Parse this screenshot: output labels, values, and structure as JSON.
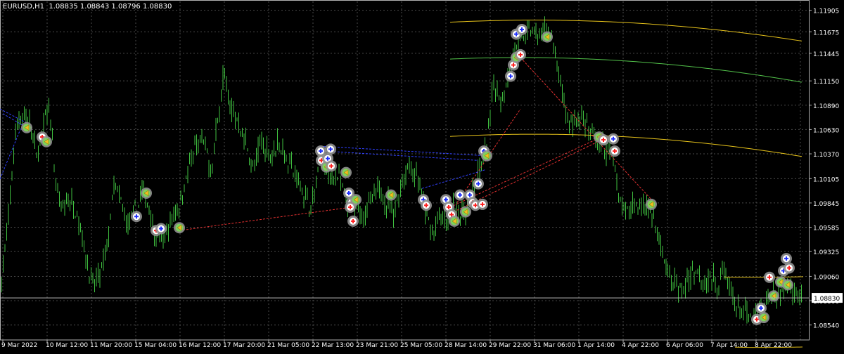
{
  "window": {
    "symbol_caption": "EURUSD,H1  1.08835 1.08843 1.08796 1.08830"
  },
  "colors": {
    "background": "#000000",
    "grid": "#4a4a4a",
    "frame": "#b0b0b0",
    "candle": "#3fbf3f",
    "channel": "#e6c21a",
    "regression_mid": "#52c24a",
    "red_link": "#e03030",
    "blue_link": "#3040ff",
    "marker_ring": "#909090",
    "price_tag_bg": "#ffffff",
    "price_tag_text": "#000000",
    "axis_text": "#ffffff"
  },
  "chart_data": {
    "type": "candlestick",
    "symbol": "EURUSD",
    "timeframe": "H1",
    "last_price": "1.08830",
    "ylim": [
      1.0838,
      1.12
    ],
    "y_ticks": [
      "1.11905",
      "1.11675",
      "1.11445",
      "1.11150",
      "1.10890",
      "1.10630",
      "1.10370",
      "1.10105",
      "1.09845",
      "1.09585",
      "1.09325",
      "1.09060",
      "1.08800",
      "1.08540"
    ],
    "x_ticks": [
      "9 Mar 2022",
      "10 Mar 12:00",
      "11 Mar 20:00",
      "15 Mar 04:00",
      "16 Mar 12:00",
      "17 Mar 20:00",
      "21 Mar 05:00",
      "22 Mar 13:00",
      "23 Mar 21:00",
      "25 Mar 05:00",
      "28 Mar 14:00",
      "29 Mar 22:00",
      "31 Mar 06:00",
      "1 Apr 14:00",
      "4 Apr 22:00",
      "6 Apr 06:00",
      "7 Apr 14:00",
      "8 Apr 22:00"
    ],
    "price_path": [
      [
        0,
        1.0895
      ],
      [
        6,
        1.0925
      ],
      [
        14,
        1.0985
      ],
      [
        22,
        1.106
      ],
      [
        30,
        1.108
      ],
      [
        40,
        1.1075
      ],
      [
        52,
        1.1035
      ],
      [
        62,
        1.1065
      ],
      [
        70,
        1.1095
      ],
      [
        78,
        1.101
      ],
      [
        88,
        1.0975
      ],
      [
        98,
        1.099
      ],
      [
        110,
        1.0975
      ],
      [
        120,
        1.0935
      ],
      [
        132,
        1.0895
      ],
      [
        144,
        1.091
      ],
      [
        152,
        1.0935
      ],
      [
        162,
        1.1005
      ],
      [
        172,
        1.0985
      ],
      [
        182,
        1.096
      ],
      [
        192,
        1.0975
      ],
      [
        202,
        1.0995
      ],
      [
        210,
        1.0985
      ],
      [
        220,
        1.095
      ],
      [
        232,
        1.0945
      ],
      [
        244,
        1.0965
      ],
      [
        256,
        1.0985
      ],
      [
        266,
        1.1015
      ],
      [
        278,
        1.1045
      ],
      [
        290,
        1.105
      ],
      [
        300,
        1.1015
      ],
      [
        310,
        1.1075
      ],
      [
        318,
        1.1125
      ],
      [
        328,
        1.1085
      ],
      [
        340,
        1.107
      ],
      [
        350,
        1.105
      ],
      [
        360,
        1.102
      ],
      [
        372,
        1.105
      ],
      [
        384,
        1.1035
      ],
      [
        396,
        1.105
      ],
      [
        408,
        1.103
      ],
      [
        420,
        1.1015
      ],
      [
        432,
        1.0995
      ],
      [
        444,
        1.098
      ],
      [
        456,
        1.1035
      ],
      [
        468,
        1.101
      ],
      [
        480,
        1.1015
      ],
      [
        492,
        1.0985
      ],
      [
        504,
        1.098
      ],
      [
        516,
        1.0975
      ],
      [
        528,
        1.0985
      ],
      [
        540,
        1.1
      ],
      [
        550,
        1.0985
      ],
      [
        560,
        1.0975
      ],
      [
        572,
        1.101
      ],
      [
        584,
        1.1025
      ],
      [
        594,
        1.101
      ],
      [
        604,
        1.0975
      ],
      [
        616,
        1.095
      ],
      [
        626,
        1.097
      ],
      [
        636,
        1.096
      ],
      [
        646,
        1.0985
      ],
      [
        656,
        1.097
      ],
      [
        666,
        1.0985
      ],
      [
        676,
        1.1005
      ],
      [
        686,
        1.103
      ],
      [
        694,
        1.106
      ],
      [
        702,
        1.111
      ],
      [
        712,
        1.1095
      ],
      [
        722,
        1.112
      ],
      [
        732,
        1.115
      ],
      [
        742,
        1.116
      ],
      [
        752,
        1.117
      ],
      [
        760,
        1.1165
      ],
      [
        768,
        1.116
      ],
      [
        776,
        1.1175
      ],
      [
        786,
        1.1155
      ],
      [
        796,
        1.1115
      ],
      [
        806,
        1.1075
      ],
      [
        816,
        1.107
      ],
      [
        826,
        1.1075
      ],
      [
        836,
        1.106
      ],
      [
        848,
        1.1055
      ],
      [
        860,
        1.104
      ],
      [
        870,
        1.104
      ],
      [
        880,
        1.0995
      ],
      [
        890,
        1.097
      ],
      [
        900,
        1.0985
      ],
      [
        910,
        1.098
      ],
      [
        920,
        1.0985
      ],
      [
        930,
        1.0965
      ],
      [
        940,
        1.0935
      ],
      [
        950,
        1.0905
      ],
      [
        960,
        1.09
      ],
      [
        970,
        1.089
      ],
      [
        980,
        1.0905
      ],
      [
        990,
        1.0915
      ],
      [
        1000,
        1.09
      ],
      [
        1010,
        1.0905
      ],
      [
        1020,
        1.0895
      ],
      [
        1030,
        1.0915
      ],
      [
        1040,
        1.0885
      ],
      [
        1050,
        1.087
      ],
      [
        1060,
        1.0865
      ],
      [
        1070,
        1.086
      ],
      [
        1080,
        1.087
      ],
      [
        1090,
        1.088
      ],
      [
        1100,
        1.0885
      ],
      [
        1110,
        1.089
      ],
      [
        1120,
        1.09
      ],
      [
        1130,
        1.089
      ],
      [
        1140,
        1.0883
      ]
    ],
    "channel_parabolas": [
      {
        "name": "upper",
        "vertex": [
          760,
          1.118
        ],
        "k": 1.55e-08,
        "x": [
          640,
          1142
        ]
      },
      {
        "name": "middle",
        "vertex": [
          740,
          1.114
        ],
        "k": 1.65e-08,
        "x": [
          640,
          1142
        ]
      },
      {
        "name": "lower",
        "vertex": [
          760,
          1.1058
        ],
        "k": 1.65e-08,
        "x": [
          640,
          1142
        ]
      },
      {
        "name": "rising-upper",
        "vertex": [
          1070,
          1.0905
        ],
        "k": 1.2e-08,
        "x": [
          1030,
          1142
        ]
      },
      {
        "name": "rising-lower",
        "vertex": [
          1085,
          1.083
        ],
        "k": 1.6e-08,
        "x": [
          1045,
          1142
        ]
      }
    ],
    "red_links": [
      [
        [
          255,
          1.0955
        ],
        [
          500,
          1.098
        ]
      ],
      [
        [
          640,
          1.098
        ],
        [
          855,
          1.1055
        ]
      ],
      [
        [
          645,
          1.0975
        ],
        [
          850,
          1.105
        ]
      ],
      [
        [
          740,
          1.114
        ],
        [
          930,
          1.0985
        ]
      ],
      [
        [
          650,
          1.0985
        ],
        [
          740,
          1.1085
        ]
      ]
    ],
    "blue_links": [
      [
        [
          0,
          1.1085
        ],
        [
          38,
          1.107
        ]
      ],
      [
        [
          4,
          1.108
        ],
        [
          38,
          1.1065
        ]
      ],
      [
        [
          0,
          1.101
        ],
        [
          30,
          1.1065
        ]
      ],
      [
        [
          460,
          1.1045
        ],
        [
          690,
          1.1035
        ]
      ],
      [
        [
          460,
          1.104
        ],
        [
          680,
          1.103
        ]
      ],
      [
        [
          600,
          1.1
        ],
        [
          690,
          1.102
        ]
      ]
    ],
    "markers": [
      [
        38,
        1.1065,
        "flag"
      ],
      [
        60,
        1.1055,
        "red"
      ],
      [
        66,
        1.105,
        "flag"
      ],
      [
        194,
        1.097,
        "blue"
      ],
      [
        208,
        1.0995,
        "flag"
      ],
      [
        222,
        1.0955,
        "red"
      ],
      [
        229,
        1.0957,
        "blue"
      ],
      [
        255,
        1.0958,
        "flag"
      ],
      [
        456,
        1.104,
        "blue"
      ],
      [
        457,
        1.103,
        "red"
      ],
      [
        464,
        1.1023,
        "flag"
      ],
      [
        470,
        1.1042,
        "blue"
      ],
      [
        466,
        1.1032,
        "blue"
      ],
      [
        471,
        1.1024,
        "red"
      ],
      [
        492,
        1.1017,
        "flag"
      ],
      [
        496,
        1.0995,
        "blue"
      ],
      [
        500,
        1.0985,
        "red"
      ],
      [
        506,
        1.0988,
        "flag"
      ],
      [
        498,
        1.098,
        "red"
      ],
      [
        502,
        1.0965,
        "red"
      ],
      [
        556,
        1.0993,
        "flag"
      ],
      [
        602,
        1.0988,
        "blue"
      ],
      [
        606,
        1.0982,
        "red"
      ],
      [
        634,
        1.0988,
        "blue"
      ],
      [
        638,
        1.098,
        "red"
      ],
      [
        642,
        1.0972,
        "red"
      ],
      [
        646,
        1.0965,
        "flag"
      ],
      [
        654,
        1.0993,
        "blue"
      ],
      [
        662,
        1.0975,
        "flag"
      ],
      [
        668,
        1.0993,
        "blue"
      ],
      [
        672,
        1.0985,
        "red"
      ],
      [
        676,
        1.0982,
        "red"
      ],
      [
        680,
        1.1005,
        "blue"
      ],
      [
        686,
        1.0983,
        "red"
      ],
      [
        688,
        1.104,
        "blue"
      ],
      [
        692,
        1.1035,
        "flag"
      ],
      [
        726,
        1.112,
        "blue"
      ],
      [
        730,
        1.1132,
        "red"
      ],
      [
        734,
        1.114,
        "flag"
      ],
      [
        740,
        1.1143,
        "red"
      ],
      [
        734,
        1.1165,
        "blue"
      ],
      [
        742,
        1.117,
        "blue"
      ],
      [
        778,
        1.1162,
        "flag"
      ],
      [
        852,
        1.1055,
        "flag"
      ],
      [
        858,
        1.1052,
        "red"
      ],
      [
        872,
        1.1053,
        "blue"
      ],
      [
        874,
        1.104,
        "red"
      ],
      [
        926,
        1.0983,
        "flag"
      ],
      [
        1076,
        1.086,
        "red"
      ],
      [
        1082,
        1.0872,
        "blue"
      ],
      [
        1086,
        1.0862,
        "flag"
      ],
      [
        1094,
        1.0905,
        "red"
      ],
      [
        1100,
        1.0885,
        "flag"
      ],
      [
        1110,
        1.09,
        "flag"
      ],
      [
        1114,
        1.0912,
        "blue"
      ],
      [
        1118,
        1.0925,
        "blue"
      ],
      [
        1122,
        1.0915,
        "red"
      ],
      [
        1120,
        1.0897,
        "flag"
      ]
    ]
  }
}
